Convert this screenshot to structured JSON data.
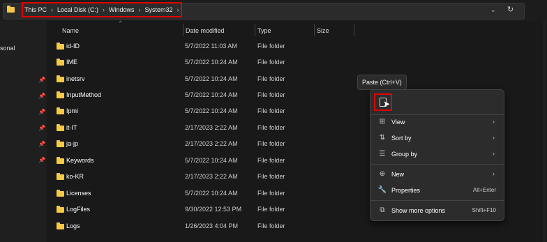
{
  "address_bar": {
    "breadcrumbs": [
      "This PC",
      "Local Disk (C:)",
      "Windows",
      "System32"
    ],
    "dropdown_icon": "chevron-down-icon",
    "refresh_icon": "refresh-icon"
  },
  "nav": {
    "partial_label": "sonal"
  },
  "columns": {
    "name": "Name",
    "date": "Date modified",
    "type": "Type",
    "size": "Size"
  },
  "rows": [
    {
      "name": "id-ID",
      "date": "5/7/2022 11:03 AM",
      "type": "File folder"
    },
    {
      "name": "IME",
      "date": "5/7/2022 10:24 AM",
      "type": "File folder"
    },
    {
      "name": "inetsrv",
      "date": "5/7/2022 10:24 AM",
      "type": "File folder"
    },
    {
      "name": "InputMethod",
      "date": "5/7/2022 10:24 AM",
      "type": "File folder"
    },
    {
      "name": "Ipmi",
      "date": "5/7/2022 10:24 AM",
      "type": "File folder"
    },
    {
      "name": "it-IT",
      "date": "2/17/2023 2:22 AM",
      "type": "File folder"
    },
    {
      "name": "ja-jp",
      "date": "2/17/2023 2:22 AM",
      "type": "File folder"
    },
    {
      "name": "Keywords",
      "date": "5/7/2022 10:24 AM",
      "type": "File folder"
    },
    {
      "name": "ko-KR",
      "date": "2/17/2023 2:22 AM",
      "type": "File folder"
    },
    {
      "name": "Licenses",
      "date": "5/7/2022 10:24 AM",
      "type": "File folder"
    },
    {
      "name": "LogFiles",
      "date": "9/30/2022 12:53 PM",
      "type": "File folder"
    },
    {
      "name": "Logs",
      "date": "1/26/2023 4:04 PM",
      "type": "File folder"
    }
  ],
  "tooltip": "Paste (Ctrl+V)",
  "context_menu": {
    "view": "View",
    "sort_by": "Sort by",
    "group_by": "Group by",
    "new": "New",
    "properties": "Properties",
    "properties_shortcut": "Alt+Enter",
    "show_more": "Show more options",
    "show_more_shortcut": "Shift+F10"
  }
}
